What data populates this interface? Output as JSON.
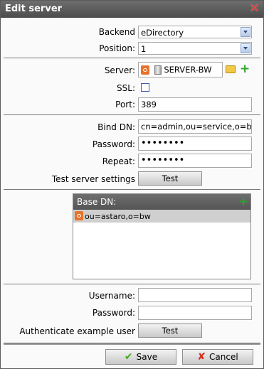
{
  "window": {
    "title": "Edit server"
  },
  "backend": {
    "label": "Backend",
    "value": "eDirectory"
  },
  "position": {
    "label": "Position:",
    "value": "1"
  },
  "server": {
    "label": "Server:",
    "value": "SERVER-BW"
  },
  "ssl": {
    "label": "SSL:"
  },
  "port": {
    "label": "Port:",
    "value": "389"
  },
  "bind_dn": {
    "label": "Bind DN:",
    "value": "cn=admin,ou=service,o=bw"
  },
  "password": {
    "label": "Password:",
    "value": "••••••••"
  },
  "repeat": {
    "label": "Repeat:",
    "value": "••••••••"
  },
  "test_server": {
    "label": "Test server settings",
    "button": "Test"
  },
  "base_dn": {
    "header": "Base DN:",
    "items": [
      "ou=astaro,o=bw"
    ]
  },
  "username": {
    "label": "Username:",
    "value": ""
  },
  "auth_password": {
    "label": "Password:",
    "value": ""
  },
  "auth_example": {
    "label": "Authenticate example user",
    "button": "Test"
  },
  "footer": {
    "save": "Save",
    "cancel": "Cancel"
  },
  "colors": {
    "title_bar": "#555555",
    "accent_green": "#2ea329",
    "accent_red": "#d83020"
  }
}
